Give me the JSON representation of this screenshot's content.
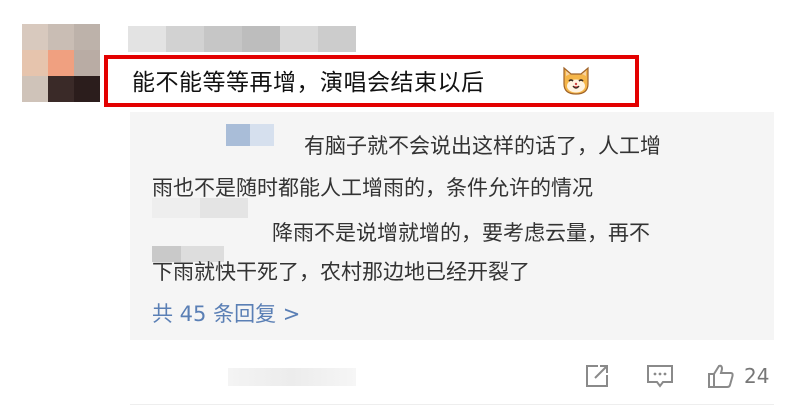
{
  "comment": {
    "text": "能不能等等再增，演唱会结束以后",
    "emoji": "cat-face-emoji"
  },
  "replies": [
    {
      "line1": "有脑子就不会说出这样的话了，人工增",
      "line2": "雨也不是随时都能人工增雨的，条件允许的情况"
    },
    {
      "line1": "降雨不是说增就增的，要考虑云量，再不",
      "line2": "下雨就快干死了，农村那边地已经开裂了"
    }
  ],
  "more_replies_label": "共 45 条回复 >",
  "actions": {
    "share_icon": "share-icon",
    "comment_icon": "comment-icon",
    "like_icon": "thumbs-up-icon",
    "like_count": "24"
  },
  "colors": {
    "highlight": "#e30000",
    "link": "#5a7fb5",
    "reply_bg": "#f5f5f5"
  }
}
